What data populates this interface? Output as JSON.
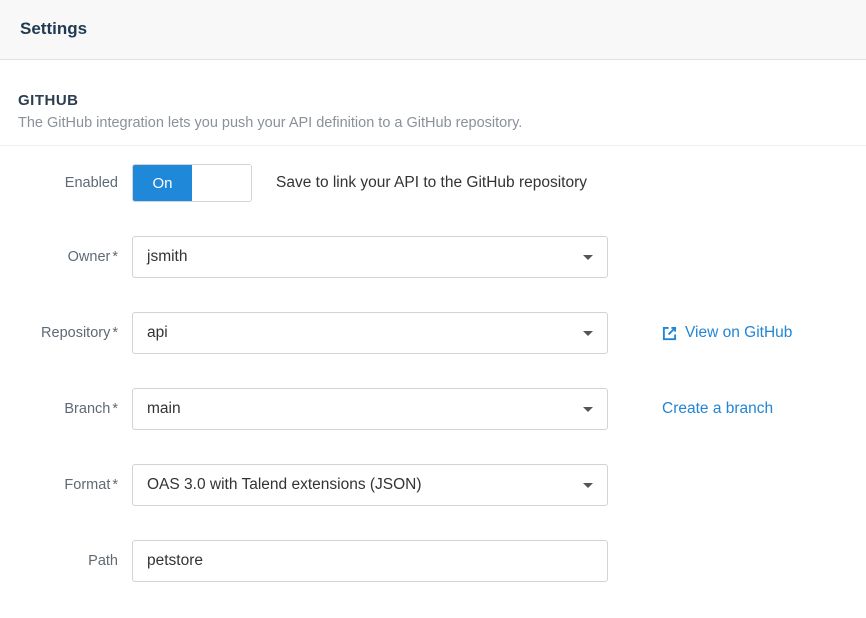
{
  "header": {
    "title": "Settings"
  },
  "section": {
    "title": "GITHUB",
    "description": "The GitHub integration lets you push your API definition to a GitHub repository."
  },
  "form": {
    "enabled": {
      "label": "Enabled",
      "on_label": "On",
      "helper": "Save to link your API to the GitHub repository"
    },
    "owner": {
      "label": "Owner",
      "required_marker": "*",
      "value": "jsmith"
    },
    "repository": {
      "label": "Repository",
      "required_marker": "*",
      "value": "api",
      "view_link": "View on GitHub"
    },
    "branch": {
      "label": "Branch",
      "required_marker": "*",
      "value": "main",
      "create_link": "Create a branch"
    },
    "format": {
      "label": "Format",
      "required_marker": "*",
      "value": "OAS 3.0 with Talend extensions (JSON)"
    },
    "path": {
      "label": "Path",
      "value": "petstore"
    }
  }
}
